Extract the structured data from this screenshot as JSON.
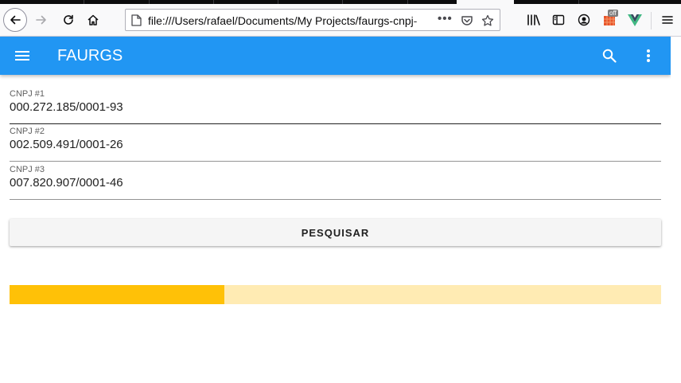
{
  "browser": {
    "url": "file:///Users/rafael/Documents/My Projects/faurgs-cnpj-",
    "page_actions": "•••",
    "badge": "off"
  },
  "appbar": {
    "title": "FAURGS",
    "color": "#2196f3",
    "icons": {
      "menu": "menu-icon",
      "search": "search-icon",
      "more": "more-vert-icon"
    }
  },
  "form": {
    "fields": [
      {
        "label": "CNPJ #1",
        "value": "000.272.185/0001-93"
      },
      {
        "label": "CNPJ #2",
        "value": "002.509.491/0001-26"
      },
      {
        "label": "CNPJ #3",
        "value": "007.820.907/0001-46"
      }
    ],
    "submit_label": "PESQUISAR"
  },
  "progress": {
    "value": 0.33,
    "color": "#ffc107",
    "track_color": "#ffebb3"
  }
}
